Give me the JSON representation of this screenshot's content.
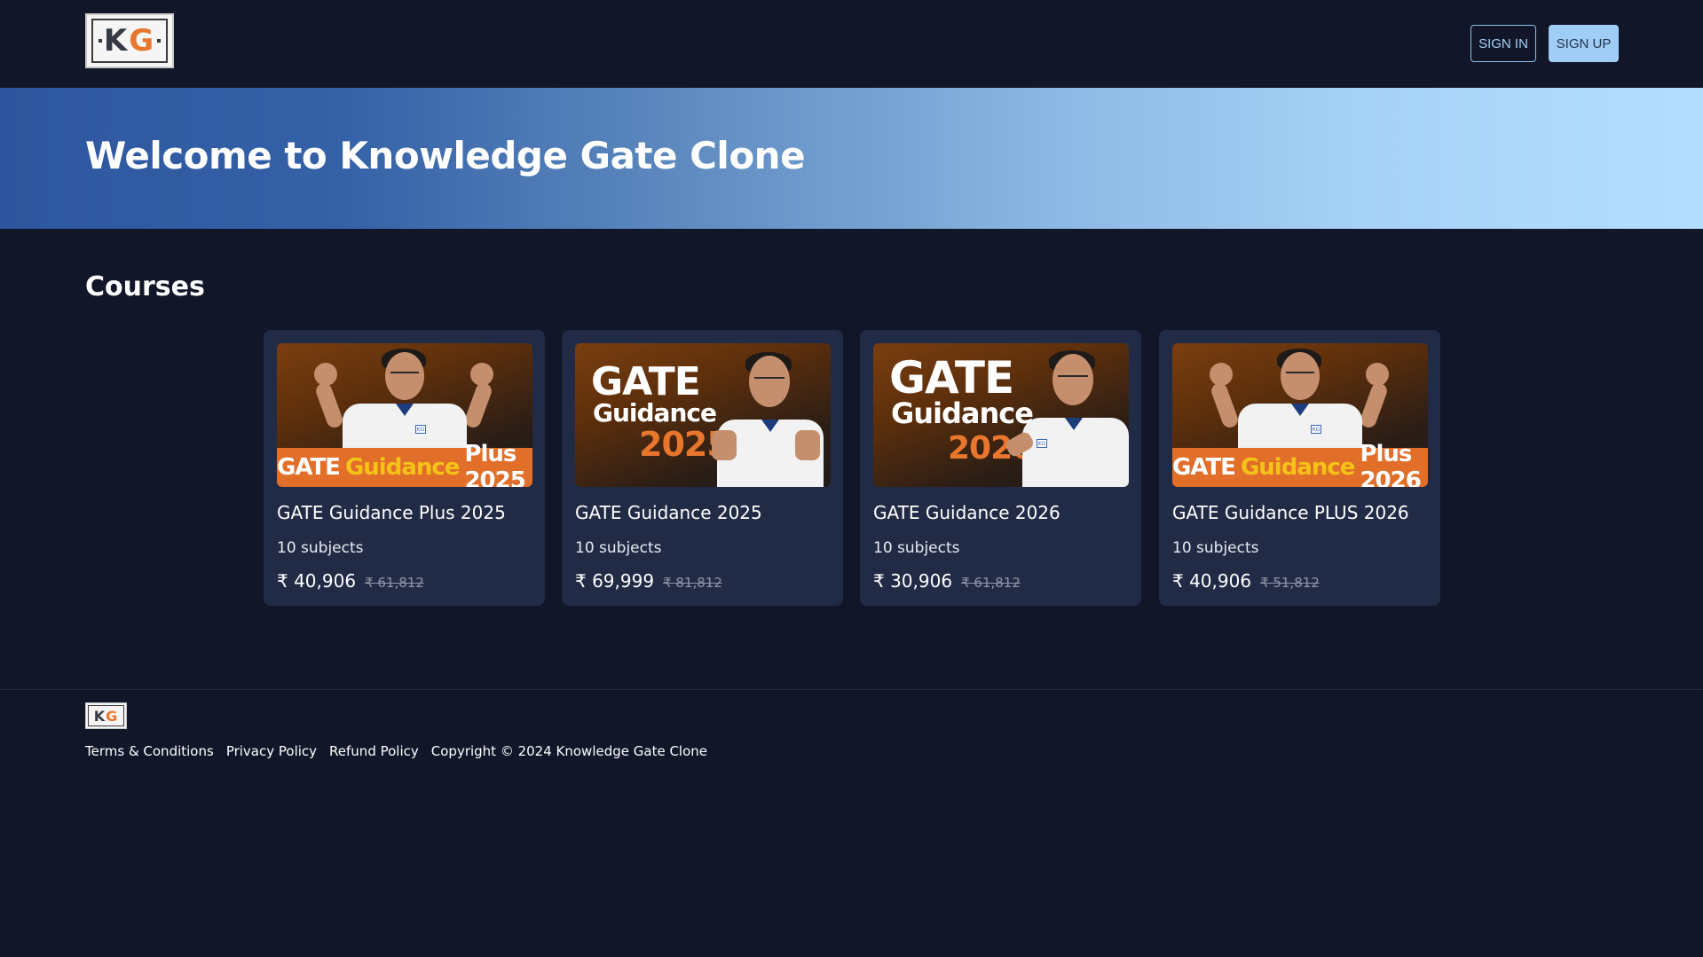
{
  "header": {
    "logo": {
      "k": "K",
      "g": "G"
    },
    "signin_label": "SIGN IN",
    "signup_label": "SIGN UP"
  },
  "hero": {
    "title": "Welcome to Knowledge Gate Clone"
  },
  "courses": {
    "section_title": "Courses",
    "items": [
      {
        "title": "GATE Guidance Plus 2025",
        "subjects": "10 subjects",
        "price": "₹ 40,906",
        "old_price": "₹ 61,812",
        "thumb": {
          "w1": "GATE",
          "w2": "Guidance",
          "w3": "Plus 2025"
        }
      },
      {
        "title": "GATE Guidance 2025",
        "subjects": "10 subjects",
        "price": "₹ 69,999",
        "old_price": "₹ 81,812",
        "thumb": {
          "w1": "GATE",
          "w2": "Guidance",
          "w3": "2025"
        }
      },
      {
        "title": "GATE Guidance 2026",
        "subjects": "10 subjects",
        "price": "₹ 30,906",
        "old_price": "₹ 61,812",
        "thumb": {
          "w1": "GATE",
          "w2": "Guidance",
          "w3": "2026"
        }
      },
      {
        "title": "GATE Guidance PLUS 2026",
        "subjects": "10 subjects",
        "price": "₹ 40,906",
        "old_price": "₹ 51,812",
        "thumb": {
          "w1": "GATE",
          "w2": "Guidance",
          "w3": "Plus 2026"
        }
      }
    ]
  },
  "footer": {
    "logo": {
      "k": "K",
      "g": "G"
    },
    "links": [
      "Terms & Conditions",
      "Privacy Policy",
      "Refund Policy"
    ],
    "copyright": "Copyright © 2024 Knowledge Gate Clone"
  },
  "colors": {
    "background": "#111629",
    "card": "#222b45",
    "accent": "#9fcdf6",
    "logo_orange": "#e8762c",
    "banner_orange": "#e16f29",
    "banner_yellow": "#f4c318"
  }
}
